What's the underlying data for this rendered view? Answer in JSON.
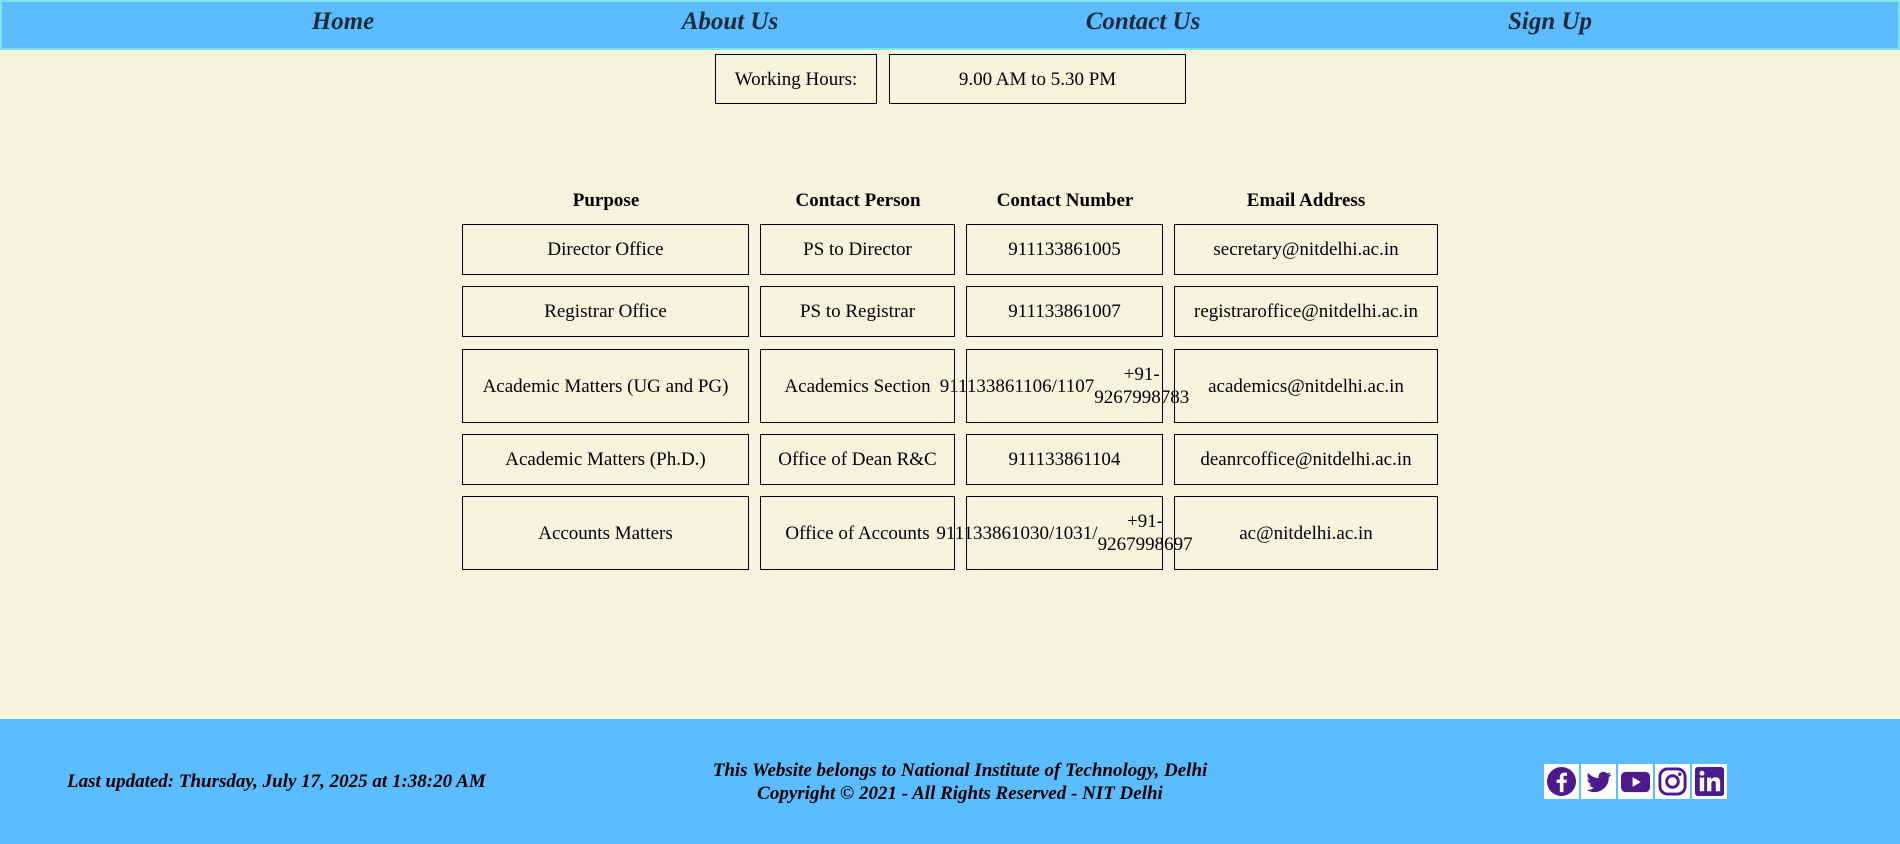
{
  "nav": {
    "items": [
      "Home",
      "About Us",
      "Contact Us",
      "Sign Up"
    ]
  },
  "hours": {
    "label": "Working Hours:",
    "value": "9.00 AM to 5.30 PM"
  },
  "table": {
    "headers": [
      "Purpose",
      "Contact Person",
      "Contact Number",
      "Email Address"
    ],
    "rows": [
      {
        "purpose": "Director Office",
        "person": "PS to Director",
        "number": [
          "911133861005"
        ],
        "email": "secretary@nitdelhi.ac.in"
      },
      {
        "purpose": "Registrar Office",
        "person": "PS to Registrar",
        "number": [
          "911133861007"
        ],
        "email": "registraroffice@nitdelhi.ac.in"
      },
      {
        "purpose": "Academic Matters (UG and PG)",
        "person": "Academics Section",
        "number": [
          "911133861106/1107",
          "+91-9267998783"
        ],
        "email": "academics@nitdelhi.ac.in"
      },
      {
        "purpose": "Academic Matters (Ph.D.)",
        "person": "Office of Dean R&C",
        "number": [
          "911133861104"
        ],
        "email": "deanrcoffice@nitdelhi.ac.in"
      },
      {
        "purpose": "Accounts Matters",
        "person": "Office of Accounts",
        "number": [
          "911133861030/1031/",
          "+91-9267998697"
        ],
        "email": "ac@nitdelhi.ac.in"
      }
    ]
  },
  "footer": {
    "last_updated": "Last updated: Thursday, July 17, 2025 at 1:38:20 AM",
    "line1": "This Website belongs to National Institute of Technology, Delhi",
    "line2": "Copyright © 2021 - All Rights Reserved - NIT Delhi",
    "social": [
      "facebook-icon",
      "twitter-icon",
      "youtube-icon",
      "instagram-icon",
      "linkedin-icon"
    ],
    "icon_color": "#4b1a8c"
  }
}
